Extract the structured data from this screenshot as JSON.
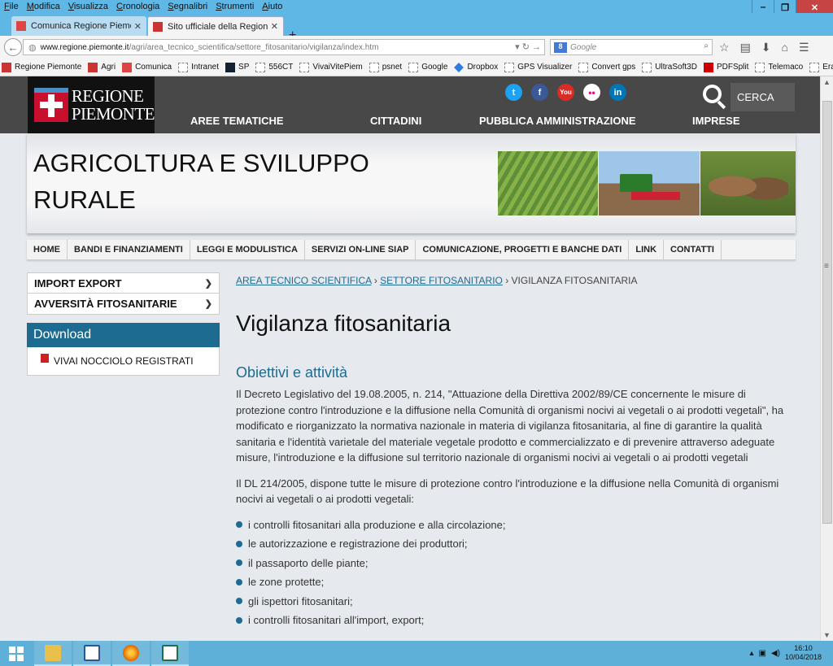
{
  "menubar": [
    "File",
    "Modifica",
    "Visualizza",
    "Cronologia",
    "Segnalibri",
    "Strumenti",
    "Aiuto"
  ],
  "tabs": [
    {
      "title": "Comunica Regione Piemo...",
      "active": false
    },
    {
      "title": "Sito ufficiale della Regione ...",
      "active": true
    }
  ],
  "url": {
    "host": "www.regione.piemonte.it",
    "path": "/agri/area_tecnico_scientifica/settore_fitosanitario/vigilanza/index.htm"
  },
  "search_placeholder": "Google",
  "bookmarks": [
    "Regione Piemonte",
    "Agri",
    "Comunica",
    "Intranet",
    "SP",
    "556CT",
    "VivaiVitePiem",
    "psnet",
    "Google",
    "Dropbox",
    "GPS Visualizer",
    "Convert gps",
    "UltraSoft3D",
    "PDFSplit",
    "Telemaco",
    "ErasmoNet"
  ],
  "site": {
    "logo_text_1": "REGIONE",
    "logo_text_2": "PIEMONTE",
    "social": [
      "t",
      "f",
      "You",
      "••",
      "in"
    ],
    "search_label": "CERCA",
    "topnav": [
      "AREE TEMATICHE",
      "CITTADINI",
      "PUBBLICA AMMINISTRAZIONE",
      "IMPRESE"
    ],
    "banner_title_1": "AGRICOLTURA E SVILUPPO",
    "banner_title_2": "RURALE",
    "secnav": [
      "HOME",
      "BANDI E FINANZIAMENTI",
      "LEGGI E MODULISTICA",
      "SERVIZI ON-LINE SIAP",
      "COMUNICAZIONE, PROGETTI E BANCHE DATI",
      "LINK",
      "CONTATTI"
    ]
  },
  "sidebar": {
    "accordion": [
      "IMPORT EXPORT",
      "AVVERSITÀ FITOSANITARIE"
    ],
    "download_title": "Download",
    "download_item": "VIVAI NOCCIOLO REGISTRATI"
  },
  "content": {
    "breadcrumb": [
      "AREA TECNICO SCIENTIFICA",
      "SETTORE FITOSANITARIO",
      "VIGILANZA FITOSANITARIA"
    ],
    "title": "Vigilanza fitosanitaria",
    "subtitle": "Obiettivi e attività",
    "para1": "Il Decreto Legislativo del 19.08.2005, n. 214, \"Attuazione della Direttiva 2002/89/CE concernente le misure di protezione contro l'introduzione e la diffusione nella Comunità di organismi nocivi ai vegetali o ai prodotti vegetali\", ha modificato e riorganizzato la normativa nazionale in materia di vigilanza fitosanitaria, al fine di garantire la qualità sanitaria e l'identità varietale del materiale vegetale prodotto e commercializzato e di prevenire attraverso adeguate misure, l'introduzione e la diffusione sul territorio nazionale di organismi nocivi ai vegetali o ai prodotti vegetali",
    "para2": "Il DL 214/2005, dispone tutte le misure di protezione contro l'introduzione e la diffusione nella Comunità di organismi nocivi ai vegetali o ai prodotti vegetali:",
    "bullets": [
      "i controlli fitosanitari alla produzione e alla circolazione;",
      "le autorizzazione e registrazione dei produttori;",
      "il passaporto delle piante;",
      "le zone protette;",
      "gli ispettori fitosanitari;",
      "i controlli fitosanitari all'import, export;"
    ]
  },
  "taskbar": {
    "time": "16:10",
    "date": "10/04/2018"
  }
}
